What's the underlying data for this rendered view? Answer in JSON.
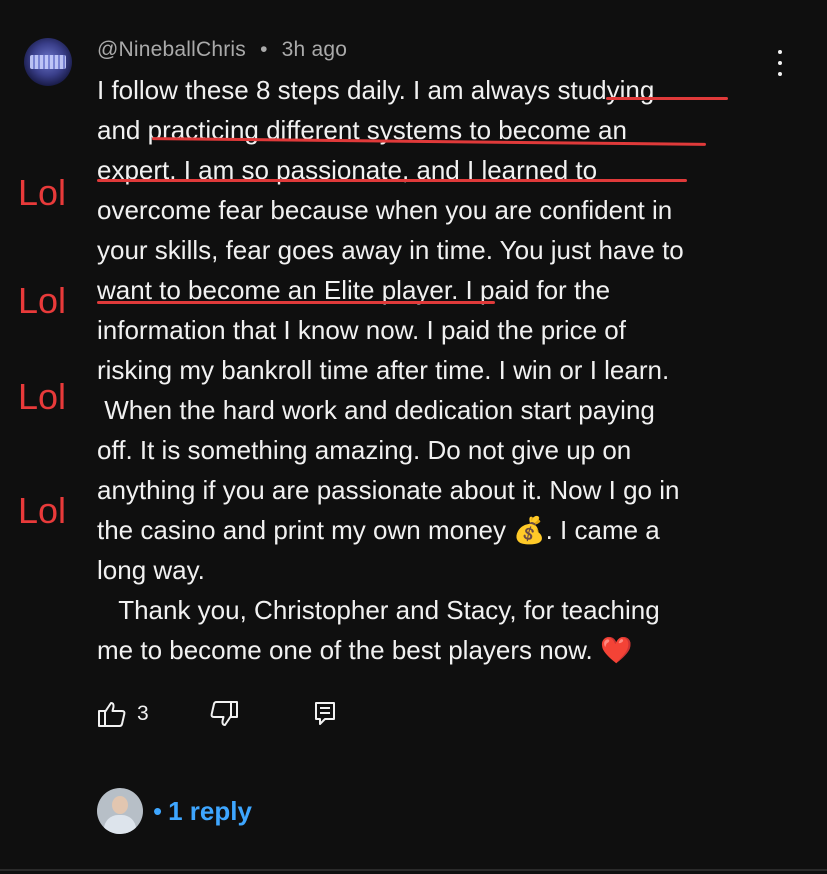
{
  "comment": {
    "author": "@NineballChris",
    "separator": "•",
    "time": "3h ago",
    "avatar_icon": "user-avatar-icon",
    "lines": [
      "I follow these 8 steps daily. I am always studying",
      "and practicing different systems to become an",
      "expert. I am so passionate, and I learned to",
      "overcome fear because when you are confident in",
      "your skills, fear goes away in time. You just have to",
      "want to become an Elite player. I paid for the",
      "information that I know now. I paid the price of",
      "risking my bankroll time after time. I win or I learn.",
      " When the hard work and dedication start paying",
      "off. It is something amazing. Do not give up on",
      "anything if you are passionate about it. Now I go in",
      "the casino and print my own money 💰. I came a",
      "long way.",
      "   Thank you, Christopher and Stacy, for teaching",
      "me to become one of the best players now. ❤️"
    ]
  },
  "annotations": {
    "lol_labels": [
      "Lol",
      "Lol",
      "Lol",
      "Lol"
    ],
    "color": "#e83a3a"
  },
  "actions": {
    "like_count": "3",
    "like_icon": "thumbs-up-icon",
    "dislike_icon": "thumbs-down-icon",
    "reply_icon": "comment-reply-icon",
    "menu_icon": "more-vertical-icon"
  },
  "replies": {
    "separator": "•",
    "label": "1 reply",
    "color": "#3ea6ff"
  },
  "theme": {
    "background": "#0f0f0f",
    "text": "#f1f1f1",
    "muted": "#aaaaaa"
  }
}
